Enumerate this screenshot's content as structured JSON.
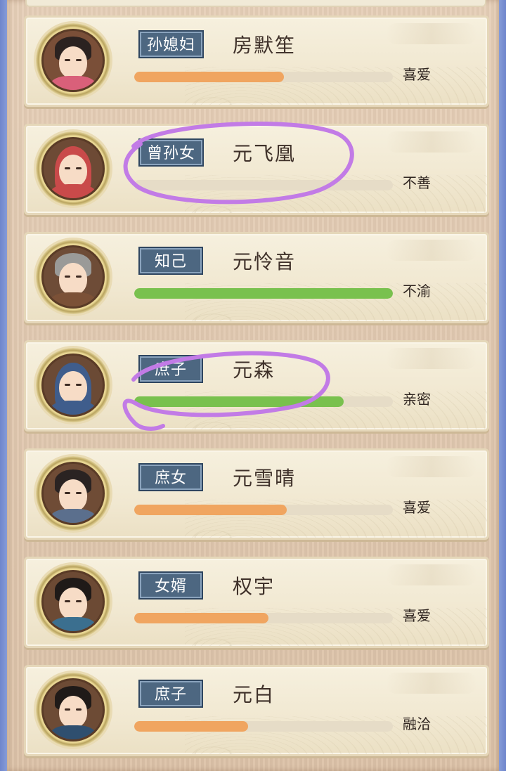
{
  "accent_colors": {
    "orange": "#f0a560",
    "green": "#79c14e",
    "tag_bg": "#4d6781",
    "annotation": "#c27be6"
  },
  "members": [
    {
      "relation": "孙媳妇",
      "name": "房默笙",
      "affection": 0.58,
      "bar_color": "#f0a560",
      "status": "喜爱",
      "avatar_icon": "noble-woman-portrait-icon"
    },
    {
      "relation": "曾孙女",
      "name": "元飞凰",
      "affection": 0.0,
      "bar_color": "#f0a560",
      "status": "不善",
      "avatar_icon": "baby-girl-portrait-icon"
    },
    {
      "relation": "知己",
      "name": "元怜音",
      "affection": 1.0,
      "bar_color": "#79c14e",
      "status": "不渝",
      "avatar_icon": "elderly-woman-portrait-icon"
    },
    {
      "relation": "庶子",
      "name": "元森",
      "affection": 0.81,
      "bar_color": "#79c14e",
      "status": "亲密",
      "avatar_icon": "baby-boy-portrait-icon"
    },
    {
      "relation": "庶女",
      "name": "元雪晴",
      "affection": 0.59,
      "bar_color": "#f0a560",
      "status": "喜爱",
      "avatar_icon": "young-woman-portrait-icon"
    },
    {
      "relation": "女婿",
      "name": "权宇",
      "affection": 0.52,
      "bar_color": "#f0a560",
      "status": "喜爱",
      "avatar_icon": "young-man-portrait-icon"
    },
    {
      "relation": "庶子",
      "name": "元白",
      "affection": 0.44,
      "bar_color": "#f0a560",
      "status": "融洽",
      "avatar_icon": "man-portrait-icon"
    }
  ]
}
